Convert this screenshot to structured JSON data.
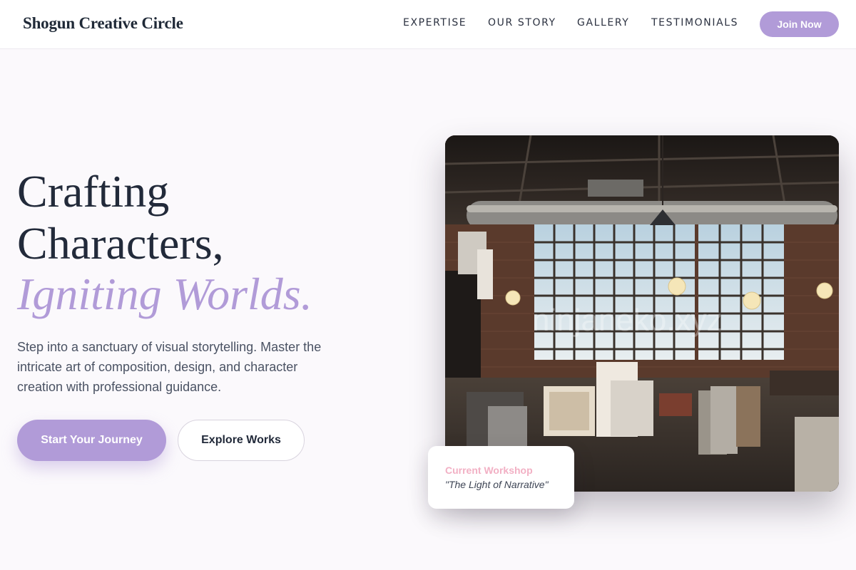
{
  "header": {
    "brand": "Shogun Creative Circle",
    "nav": [
      "EXPERTISE",
      "OUR STORY",
      "GALLERY",
      "TESTIMONIALS"
    ],
    "join_label": "Join Now"
  },
  "hero": {
    "title_line1": "Crafting",
    "title_line2": "Characters,",
    "title_accent": "Igniting Worlds.",
    "lead": "Step into a sanctuary of visual storytelling. Master the intricate art of composition, design, and character creation with professional guidance.",
    "primary_cta": "Start Your Journey",
    "secondary_cta": "Explore Works"
  },
  "image": {
    "watermark": "ninjaneko.xyz"
  },
  "workshop_card": {
    "label": "Current Workshop",
    "title": "\"The Light of Narrative\""
  },
  "colors": {
    "accent": "#b19bd8",
    "heading": "#222a3a",
    "card_label": "#f2b0c4",
    "background": "#fbf9fc"
  }
}
